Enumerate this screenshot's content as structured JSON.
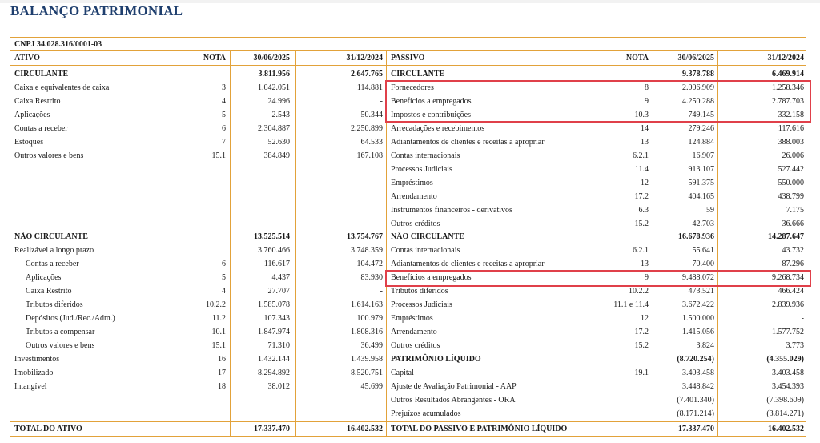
{
  "title": "BALANÇO PATRIMONIAL",
  "cnpj": "CNPJ 34.028.316/0001-03",
  "headers": {
    "ativo": "ATIVO",
    "passivo": "PASSIVO",
    "nota": "NOTA",
    "col1": "30/06/2025",
    "col2": "31/12/2024"
  },
  "ativo_rows": [
    {
      "label": "CIRCULANTE",
      "nota": "",
      "v1": "3.811.956",
      "v2": "2.647.765",
      "bold": true
    },
    {
      "label": "Caixa e equivalentes de caixa",
      "nota": "3",
      "v1": "1.042.051",
      "v2": "114.881"
    },
    {
      "label": "Caixa Restrito",
      "nota": "4",
      "v1": "24.996",
      "v2": "-"
    },
    {
      "label": "Aplicações",
      "nota": "5",
      "v1": "2.543",
      "v2": "50.344"
    },
    {
      "label": "Contas a receber",
      "nota": "6",
      "v1": "2.304.887",
      "v2": "2.250.899"
    },
    {
      "label": "Estoques",
      "nota": "7",
      "v1": "52.630",
      "v2": "64.533"
    },
    {
      "label": "Outros valores e bens",
      "nota": "15.1",
      "v1": "384.849",
      "v2": "167.108"
    },
    {
      "label": "NÃO CIRCULANTE",
      "nota": "",
      "v1": "13.525.514",
      "v2": "13.754.767",
      "bold": true
    },
    {
      "label": "Realizável a longo prazo",
      "nota": "",
      "v1": "3.760.466",
      "v2": "3.748.359"
    },
    {
      "label": "Contas a receber",
      "nota": "6",
      "v1": "116.617",
      "v2": "104.472",
      "indent": true
    },
    {
      "label": "Aplicações",
      "nota": "5",
      "v1": "4.437",
      "v2": "83.930",
      "indent": true
    },
    {
      "label": "Caixa Restrito",
      "nota": "4",
      "v1": "27.707",
      "v2": "-",
      "indent": true
    },
    {
      "label": "Tributos diferidos",
      "nota": "10.2.2",
      "v1": "1.585.078",
      "v2": "1.614.163",
      "indent": true
    },
    {
      "label": "Depósitos (Jud./Rec./Adm.)",
      "nota": "11.2",
      "v1": "107.343",
      "v2": "100.979",
      "indent": true
    },
    {
      "label": "Tributos a compensar",
      "nota": "10.1",
      "v1": "1.847.974",
      "v2": "1.808.316",
      "indent": true
    },
    {
      "label": "Outros valores e bens",
      "nota": "15.1",
      "v1": "71.310",
      "v2": "36.499",
      "indent": true
    },
    {
      "label": "Investimentos",
      "nota": "16",
      "v1": "1.432.144",
      "v2": "1.439.958"
    },
    {
      "label": "Imobilizado",
      "nota": "17",
      "v1": "8.294.892",
      "v2": "8.520.751"
    },
    {
      "label": "Intangível",
      "nota": "18",
      "v1": "38.012",
      "v2": "45.699"
    }
  ],
  "passivo_rows": [
    {
      "label": "CIRCULANTE",
      "nota": "",
      "v1": "9.378.788",
      "v2": "6.469.914",
      "bold": true
    },
    {
      "label": "Fornecedores",
      "nota": "8",
      "v1": "2.006.909",
      "v2": "1.258.346"
    },
    {
      "label": "Benefícios a empregados",
      "nota": "9",
      "v1": "4.250.288",
      "v2": "2.787.703"
    },
    {
      "label": "Impostos e contribuições",
      "nota": "10.3",
      "v1": "749.145",
      "v2": "332.158"
    },
    {
      "label": "Arrecadações e recebimentos",
      "nota": "14",
      "v1": "279.246",
      "v2": "117.616"
    },
    {
      "label": "Adiantamentos de clientes e receitas a apropriar",
      "nota": "13",
      "v1": "124.884",
      "v2": "388.003"
    },
    {
      "label": "Contas internacionais",
      "nota": "6.2.1",
      "v1": "16.907",
      "v2": "26.006"
    },
    {
      "label": "Processos Judiciais",
      "nota": "11.4",
      "v1": "913.107",
      "v2": "527.442"
    },
    {
      "label": "Empréstimos",
      "nota": "12",
      "v1": "591.375",
      "v2": "550.000"
    },
    {
      "label": "Arrendamento",
      "nota": "17.2",
      "v1": "404.165",
      "v2": "438.799"
    },
    {
      "label": "Instrumentos financeiros - derivativos",
      "nota": "6.3",
      "v1": "59",
      "v2": "7.175"
    },
    {
      "label": "Outros créditos",
      "nota": "15.2",
      "v1": "42.703",
      "v2": "36.666"
    },
    {
      "label": "NÃO CIRCULANTE",
      "nota": "",
      "v1": "16.678.936",
      "v2": "14.287.647",
      "bold": true
    },
    {
      "label": "Contas internacionais",
      "nota": "6.2.1",
      "v1": "55.641",
      "v2": "43.732"
    },
    {
      "label": "Adiantamentos de clientes e receitas a apropriar",
      "nota": "13",
      "v1": "70.400",
      "v2": "87.296"
    },
    {
      "label": "Benefícios a empregados",
      "nota": "9",
      "v1": "9.488.072",
      "v2": "9.268.734"
    },
    {
      "label": "Tributos diferidos",
      "nota": "10.2.2",
      "v1": "473.521",
      "v2": "466.424"
    },
    {
      "label": "Processos Judiciais",
      "nota": "11.1 e 11.4",
      "v1": "3.672.422",
      "v2": "2.839.936"
    },
    {
      "label": "Empréstimos",
      "nota": "12",
      "v1": "1.500.000",
      "v2": "-"
    },
    {
      "label": "Arrendamento",
      "nota": "17.2",
      "v1": "1.415.056",
      "v2": "1.577.752"
    },
    {
      "label": "Outros créditos",
      "nota": "15.2",
      "v1": "3.824",
      "v2": "3.773"
    },
    {
      "label": "PATRIMÔNIO LÍQUIDO",
      "nota": "",
      "v1": "(8.720.254)",
      "v2": "(4.355.029)",
      "bold": true
    },
    {
      "label": "Capital",
      "nota": "19.1",
      "v1": "3.403.458",
      "v2": "3.403.458"
    },
    {
      "label": "Ajuste de Avaliação Patrimonial - AAP",
      "nota": "",
      "v1": "3.448.842",
      "v2": "3.454.393"
    },
    {
      "label": "Outros Resultados Abrangentes - ORA",
      "nota": "",
      "v1": "(7.401.340)",
      "v2": "(7.398.609)"
    },
    {
      "label": "Prejuízos acumulados",
      "nota": "",
      "v1": "(8.171.214)",
      "v2": "(3.814.271)"
    }
  ],
  "totals": {
    "ativo_label": "TOTAL DO ATIVO",
    "ativo_v1": "17.337.470",
    "ativo_v2": "16.402.532",
    "passivo_label": "TOTAL DO PASSIVO E PATRIMÔNIO LÍQUIDO",
    "passivo_v1": "17.337.470",
    "passivo_v2": "16.402.532"
  },
  "highlight_color": "#e0404a",
  "rule_color": "#e2a23a"
}
